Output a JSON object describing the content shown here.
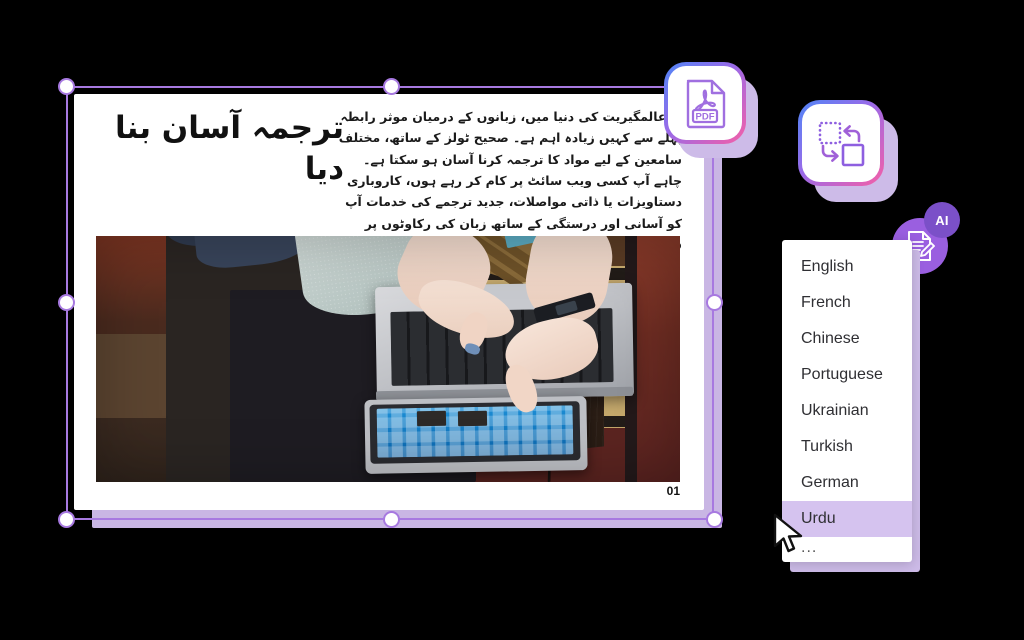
{
  "canvas": {
    "background": "#000000",
    "accent": "#a779e0",
    "accent_light": "#cdbbe8",
    "highlight": "#d5c3ef"
  },
  "slide": {
    "title": "ترجمہ آسان بنا دیا",
    "body": "ی عالمگیریت کی دنیا میں، زبانوں کے درمیان موثر رابطہ پہلے سے کہیں زیادہ اہم ہے۔ صحیح ٹولز کے ساتھ، مختلف سامعین کے لیے مواد کا ترجمہ کرنا آسان ہو سکتا ہے۔ چاہے آپ کسی ویب سائٹ پر کام کر رہے ہوں، کاروباری دستاویزات یا ذاتی مواصلات، جدید ترجمے کی خدمات آپ کو آسانی اور درستگی کے ساتھ زبان کی رکاوٹوں پر قابو پانے کی اجازت دیتی ہیں۔",
    "page_number": "01",
    "photo_alt": "two-hands-typing-on-laptop-and-tablet-photo"
  },
  "floating_icons": [
    {
      "name": "pdf-file-icon",
      "label": "PDF"
    },
    {
      "name": "convert-format-icon",
      "label": ""
    }
  ],
  "ai_badge": {
    "label": "AI",
    "icon": "document-edit-icon"
  },
  "dropdown": {
    "name": "language-dropdown",
    "selected": "Urdu",
    "items": [
      {
        "label": "English",
        "selected": false
      },
      {
        "label": "French",
        "selected": false
      },
      {
        "label": "Chinese",
        "selected": false
      },
      {
        "label": "Portuguese",
        "selected": false
      },
      {
        "label": "Ukrainian",
        "selected": false
      },
      {
        "label": "Turkish",
        "selected": false
      },
      {
        "label": "German",
        "selected": false
      },
      {
        "label": "Urdu",
        "selected": true
      },
      {
        "label": "...",
        "selected": false
      }
    ]
  }
}
